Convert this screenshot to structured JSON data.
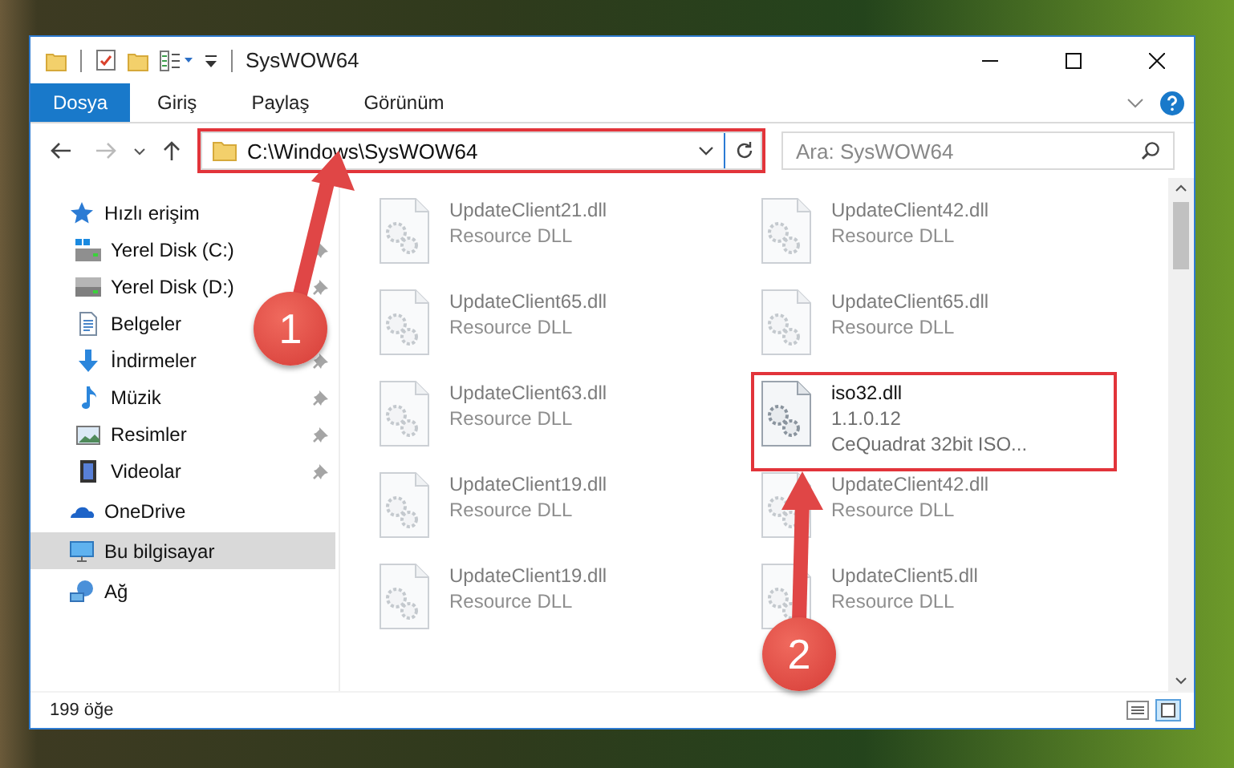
{
  "window": {
    "title": "SysWOW64"
  },
  "ribbon": {
    "tabs": [
      {
        "label": "Dosya",
        "selected": true
      },
      {
        "label": "Giriş",
        "selected": false
      },
      {
        "label": "Paylaş",
        "selected": false
      },
      {
        "label": "Görünüm",
        "selected": false
      }
    ]
  },
  "address_bar": {
    "path": "C:\\Windows\\SysWOW64",
    "highlighted": true
  },
  "search": {
    "placeholder": "Ara: SysWOW64"
  },
  "sidebar": {
    "items": [
      {
        "label": "Hızlı erişim",
        "kind": "star",
        "selected": false,
        "pinned": false,
        "children": [
          {
            "label": "Yerel Disk (C:)",
            "kind": "system-drive",
            "selected": false,
            "pinned": true
          },
          {
            "label": "Yerel Disk (D:)",
            "kind": "drive",
            "selected": false,
            "pinned": true
          },
          {
            "label": "Belgeler",
            "kind": "documents",
            "selected": false,
            "pinned": false
          },
          {
            "label": "İndirmeler",
            "kind": "download",
            "selected": false,
            "pinned": true
          },
          {
            "label": "Müzik",
            "kind": "music",
            "selected": false,
            "pinned": true
          },
          {
            "label": "Resimler",
            "kind": "pictures",
            "selected": false,
            "pinned": true
          },
          {
            "label": "Videolar",
            "kind": "videos",
            "selected": false,
            "pinned": true
          }
        ]
      },
      {
        "label": "OneDrive",
        "kind": "cloud",
        "selected": false,
        "pinned": false
      },
      {
        "label": "Bu bilgisayar",
        "kind": "computer",
        "selected": true,
        "pinned": false
      },
      {
        "label": "Ağ",
        "kind": "network",
        "selected": false,
        "pinned": false
      }
    ]
  },
  "files": [
    {
      "name": "UpdateClient21.dll",
      "details": [
        "Resource DLL"
      ],
      "blurred": true,
      "highlighted": false
    },
    {
      "name": "UpdateClient42.dll",
      "details": [
        "Resource DLL"
      ],
      "blurred": true,
      "highlighted": false
    },
    {
      "name": "UpdateClient65.dll",
      "details": [
        "Resource DLL"
      ],
      "blurred": true,
      "highlighted": false
    },
    {
      "name": "UpdateClient65.dll",
      "details": [
        "Resource DLL"
      ],
      "blurred": true,
      "highlighted": false
    },
    {
      "name": "UpdateClient63.dll",
      "details": [
        "Resource DLL"
      ],
      "blurred": true,
      "highlighted": false
    },
    {
      "name": "iso32.dll",
      "details": [
        "1.1.0.12",
        "CeQuadrat 32bit ISO..."
      ],
      "blurred": false,
      "highlighted": true
    },
    {
      "name": "UpdateClient19.dll",
      "details": [
        "Resource DLL"
      ],
      "blurred": true,
      "highlighted": false
    },
    {
      "name": "UpdateClient42.dll",
      "details": [
        "Resource DLL"
      ],
      "blurred": true,
      "highlighted": false
    },
    {
      "name": "UpdateClient19.dll",
      "details": [
        "Resource DLL"
      ],
      "blurred": true,
      "highlighted": false
    },
    {
      "name": "UpdateClient5.dll",
      "details": [
        "Resource DLL"
      ],
      "blurred": true,
      "highlighted": false
    }
  ],
  "status_bar": {
    "count": "199 öğe"
  },
  "annotations": [
    {
      "number": "1"
    },
    {
      "number": "2"
    }
  ]
}
